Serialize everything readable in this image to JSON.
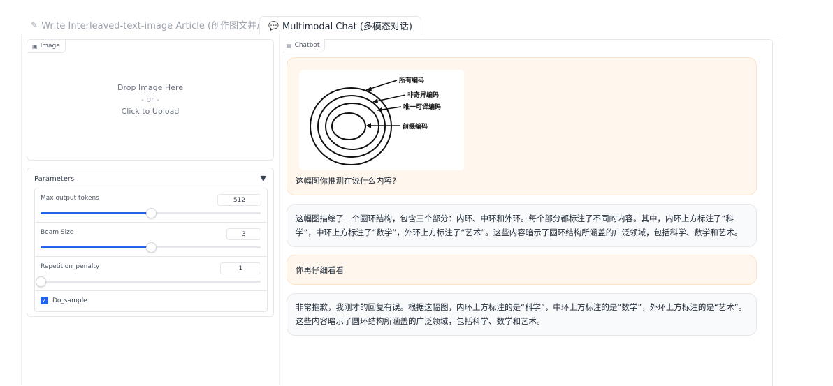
{
  "tabs": [
    {
      "icon": "pencil-icon",
      "label": "Write Interleaved-text-image Article (创作图文并茂文章)"
    },
    {
      "icon": "chat-bubble-icon",
      "label": "Multimodal Chat (多模态对话)"
    }
  ],
  "image_upload": {
    "label": "Image",
    "drop_text": "Drop Image Here",
    "or_text": "- or -",
    "click_text": "Click to Upload"
  },
  "parameters": {
    "title": "Parameters",
    "toggle_icon": "▼",
    "max_tokens": {
      "label": "Max output tokens",
      "value": "512",
      "fraction": 0.5
    },
    "beam_size": {
      "label": "Beam Size",
      "value": "3",
      "fraction": 0.5
    },
    "repetition_penalty": {
      "label": "Repetition_penalty",
      "value": "1",
      "fraction": 0.0
    },
    "do_sample": {
      "label": "Do_sample",
      "checked": true
    }
  },
  "chatbot": {
    "label": "Chatbot",
    "messages": [
      {
        "role": "user",
        "diagram_labels": [
          "所有编码",
          "非奇异编码",
          "唯一可译编码",
          "前缀编码"
        ],
        "text": "这幅图你推测在说什么内容?"
      },
      {
        "role": "bot",
        "text": "这幅图描绘了一个圆环结构，包含三个部分：内环、中环和外环。每个部分都标注了不同的内容。其中，内环上方标注了“科学”，中环上方标注了“数学”，外环上方标注了“艺术”。这些内容暗示了圆环结构所涵盖的广泛领域，包括科学、数学和艺术。"
      },
      {
        "role": "user",
        "text": "你再仔细看看"
      },
      {
        "role": "bot",
        "text": "非常抱歉，我刚才的回复有误。根据这幅图，内环上方标注的是“科学”，中环上方标注的是“数学”，外环上方标注的是“艺术”。这些内容暗示了圆环结构所涵盖的广泛领域，包括科学、数学和艺术。"
      }
    ]
  }
}
